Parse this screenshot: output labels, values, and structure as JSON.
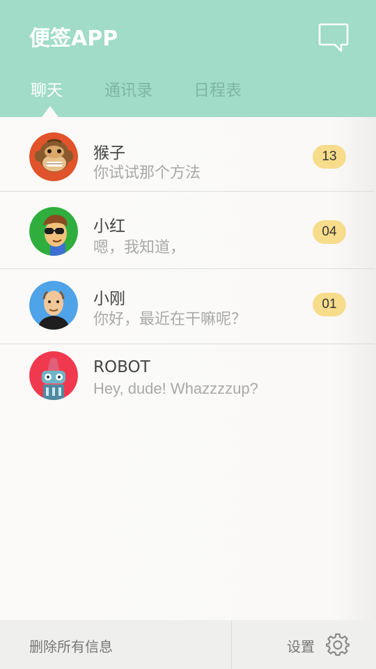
{
  "header": {
    "app_title": "便签APP",
    "background_color": "#a0dcc8",
    "tabs": [
      {
        "label": "聊天",
        "active": true
      },
      {
        "label": "通讯录",
        "active": false
      },
      {
        "label": "日程表",
        "active": false
      }
    ],
    "icon": "chat-bubble-icon"
  },
  "conversations": [
    {
      "name": "猴子",
      "message": "你试试那个方法",
      "badge": "13",
      "avatar": "monkey-avatar"
    },
    {
      "name": "小红",
      "message": "嗯，我知道，",
      "badge": "04",
      "avatar": "cartoon-man-sunglasses-avatar"
    },
    {
      "name": "小刚",
      "message": "你好，最近在干嘛呢？",
      "badge": "01",
      "avatar": "bald-man-avatar"
    },
    {
      "name": "ROBOT",
      "message": "Hey, dude! Whazzzzup?",
      "badge": "",
      "avatar": "robot-avatar"
    }
  ],
  "footer": {
    "delete_all": "删除所有信息",
    "settings": "设置",
    "settings_icon": "gear-icon"
  },
  "colors": {
    "accent": "#a0dcc8",
    "badge": "#f7dc8c",
    "divider": "#dcdcda"
  }
}
